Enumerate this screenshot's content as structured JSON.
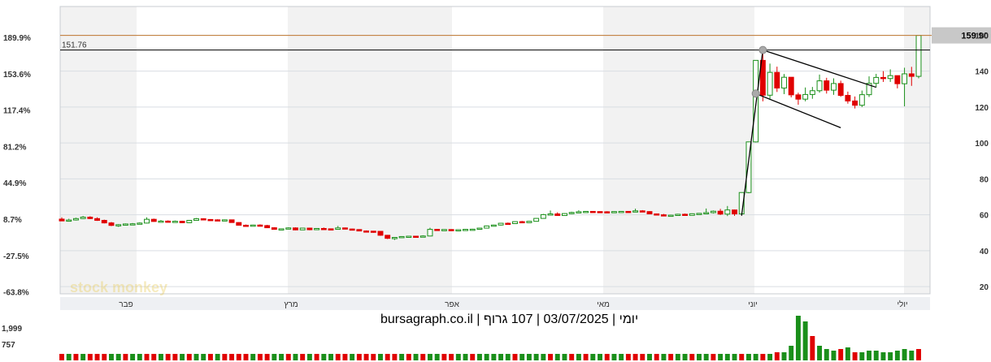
{
  "chart_data": {
    "type": "candlestick",
    "caption": "יומי | 03/07/2025 | 107 גרוף | bursagraph.co.il",
    "watermark": "stock monkey",
    "months": [
      "פבר",
      "מרץ",
      "אפר",
      "מאי",
      "יוני",
      "יולי"
    ],
    "y_right": {
      "ticks": [
        20,
        40,
        60,
        80,
        100,
        120,
        140,
        160
      ],
      "range": [
        16,
        176
      ]
    },
    "y_left_pct_ticks": [
      "189.9%",
      "153.6%",
      "117.4%",
      "81.2%",
      "44.9%",
      "8.7%",
      "-27.5%",
      "-63.8%"
    ],
    "volume_ticks": [
      "1,999",
      "757"
    ],
    "last_price_label": "159.90",
    "last_price": 159.9,
    "reference_level_label": "151.76",
    "reference_level": 151.76,
    "colors": {
      "up": "#1a8f1a",
      "down": "#e00000",
      "up_body": "#ffffff",
      "orange_line": "#c07830",
      "price_box": "#c8c8c8",
      "band": "#f2f2f2"
    },
    "candles": [
      [
        57.6,
        58.6,
        56.6,
        56.6
      ],
      [
        56.6,
        57.8,
        56.2,
        57.1
      ],
      [
        57.1,
        58.4,
        56.8,
        57.9
      ],
      [
        57.9,
        59.3,
        57.6,
        58.7
      ],
      [
        58.7,
        59.2,
        57.6,
        57.9
      ],
      [
        57.9,
        58.6,
        56.6,
        56.9
      ],
      [
        56.9,
        57.3,
        55.2,
        55.5
      ],
      [
        55.5,
        56.0,
        53.7,
        54.1
      ],
      [
        54.1,
        54.8,
        53.3,
        54.5
      ],
      [
        54.5,
        55.2,
        54.3,
        54.9
      ],
      [
        54.9,
        55.4,
        54.6,
        55.0
      ],
      [
        55.0,
        55.8,
        54.8,
        55.4
      ],
      [
        55.4,
        58.6,
        55.2,
        57.5
      ],
      [
        57.5,
        57.9,
        56.1,
        56.3
      ],
      [
        56.3,
        57.1,
        55.8,
        56.5
      ],
      [
        56.5,
        56.9,
        55.7,
        55.9
      ],
      [
        55.9,
        56.8,
        55.6,
        56.4
      ],
      [
        56.4,
        56.7,
        55.4,
        55.6
      ],
      [
        55.6,
        57.1,
        55.4,
        56.9
      ],
      [
        56.9,
        58.2,
        56.7,
        57.8
      ],
      [
        57.8,
        58.1,
        57.1,
        57.4
      ],
      [
        57.4,
        57.6,
        56.9,
        57.2
      ],
      [
        57.2,
        57.5,
        56.8,
        57.0
      ],
      [
        57.0,
        57.4,
        56.6,
        57.2
      ],
      [
        57.2,
        57.3,
        55.6,
        55.7
      ],
      [
        55.7,
        55.9,
        54.0,
        54.2
      ],
      [
        54.2,
        54.6,
        53.6,
        53.9
      ],
      [
        53.9,
        54.5,
        53.7,
        54.3
      ],
      [
        54.3,
        54.7,
        53.9,
        54.0
      ],
      [
        54.0,
        54.4,
        52.6,
        52.8
      ],
      [
        52.8,
        53.1,
        51.7,
        51.9
      ],
      [
        51.9,
        52.3,
        51.8,
        52.2
      ],
      [
        52.2,
        53.0,
        52.0,
        52.7
      ],
      [
        52.7,
        53.0,
        51.4,
        51.6
      ],
      [
        51.6,
        52.8,
        51.5,
        52.6
      ],
      [
        52.6,
        52.8,
        51.4,
        51.7
      ],
      [
        51.7,
        52.6,
        51.6,
        52.4
      ],
      [
        52.4,
        52.9,
        52.1,
        52.2
      ],
      [
        52.2,
        52.4,
        51.6,
        51.9
      ],
      [
        51.9,
        53.8,
        51.8,
        52.7
      ],
      [
        52.7,
        52.9,
        51.9,
        52.1
      ],
      [
        52.1,
        52.3,
        51.6,
        51.8
      ],
      [
        51.8,
        52.0,
        50.9,
        51.0
      ],
      [
        51.0,
        51.3,
        50.7,
        50.9
      ],
      [
        50.9,
        51.0,
        50.0,
        50.8
      ],
      [
        50.8,
        50.9,
        48.3,
        48.6
      ],
      [
        48.6,
        48.8,
        46.5,
        46.9
      ],
      [
        46.9,
        47.2,
        46.0,
        47.4
      ],
      [
        47.4,
        48.1,
        47.1,
        47.9
      ],
      [
        47.9,
        48.2,
        47.4,
        48.1
      ],
      [
        48.1,
        48.3,
        47.9,
        48.0
      ],
      [
        48.0,
        48.6,
        47.9,
        48.2
      ],
      [
        48.2,
        52.8,
        48.0,
        51.9
      ],
      [
        51.9,
        52.1,
        51.4,
        51.7
      ],
      [
        51.7,
        51.9,
        51.5,
        51.8
      ],
      [
        51.8,
        52.0,
        51.4,
        51.6
      ],
      [
        51.6,
        51.9,
        51.5,
        51.7
      ],
      [
        51.7,
        52.0,
        51.5,
        51.9
      ],
      [
        51.9,
        52.2,
        51.6,
        52.0
      ],
      [
        52.0,
        52.8,
        51.9,
        52.6
      ],
      [
        52.6,
        54.0,
        52.4,
        53.8
      ],
      [
        53.8,
        54.5,
        53.5,
        54.3
      ],
      [
        54.3,
        55.5,
        54.0,
        55.3
      ],
      [
        55.3,
        55.7,
        54.8,
        55.1
      ],
      [
        55.1,
        56.4,
        55.0,
        56.2
      ],
      [
        56.2,
        56.6,
        55.4,
        55.6
      ],
      [
        55.6,
        56.6,
        55.4,
        56.4
      ],
      [
        56.4,
        58.2,
        56.2,
        58.0
      ],
      [
        58.0,
        60.5,
        57.8,
        60.1
      ],
      [
        60.1,
        62.4,
        59.8,
        60.5
      ],
      [
        60.5,
        61.4,
        59.4,
        59.6
      ],
      [
        59.6,
        60.9,
        59.5,
        60.7
      ],
      [
        60.7,
        61.7,
        60.4,
        61.3
      ],
      [
        61.3,
        62.5,
        61.0,
        61.7
      ],
      [
        61.7,
        62.1,
        61.4,
        61.9
      ],
      [
        61.9,
        62.1,
        61.5,
        61.8
      ],
      [
        61.8,
        62.0,
        61.5,
        61.7
      ],
      [
        61.7,
        62.0,
        61.4,
        61.6
      ],
      [
        61.6,
        61.9,
        61.4,
        61.8
      ],
      [
        61.8,
        62.0,
        61.6,
        61.9
      ],
      [
        61.9,
        62.1,
        61.5,
        61.7
      ],
      [
        61.7,
        63.4,
        61.6,
        62.2
      ],
      [
        62.2,
        62.6,
        61.5,
        61.8
      ],
      [
        61.8,
        62.0,
        60.3,
        60.5
      ],
      [
        60.5,
        60.7,
        59.8,
        60.0
      ],
      [
        60.0,
        60.5,
        59.3,
        59.5
      ],
      [
        59.5,
        60.1,
        59.2,
        59.8
      ],
      [
        59.8,
        60.6,
        59.6,
        60.3
      ],
      [
        60.3,
        60.7,
        59.5,
        59.7
      ],
      [
        59.7,
        60.8,
        59.6,
        60.6
      ],
      [
        60.6,
        61.0,
        60.2,
        60.8
      ],
      [
        60.8,
        63.5,
        60.6,
        61.2
      ],
      [
        61.2,
        62.4,
        60.7,
        62.0
      ],
      [
        62.0,
        63.3,
        59.9,
        60.4
      ],
      [
        60.4,
        64.9,
        59.3,
        62.7
      ],
      [
        62.7,
        62.9,
        59.4,
        60.5
      ],
      [
        60.5,
        70.8,
        60.3,
        72.4
      ],
      [
        72.4,
        98.2,
        72.0,
        100.6
      ],
      [
        100.6,
        141.9,
        100.3,
        146.0
      ],
      [
        146.0,
        151.0,
        123.2,
        126.6
      ],
      [
        126.6,
        144.2,
        124.0,
        139.3
      ],
      [
        139.3,
        142.5,
        128.4,
        130.6
      ],
      [
        130.6,
        138.4,
        127.2,
        136.6
      ],
      [
        136.6,
        135.7,
        125.4,
        126.8
      ],
      [
        126.8,
        128.0,
        121.3,
        124.4
      ],
      [
        124.4,
        130.9,
        123.2,
        127.0
      ],
      [
        127.0,
        131.2,
        124.6,
        129.1
      ],
      [
        129.1,
        138.1,
        128.0,
        134.6
      ],
      [
        134.6,
        136.3,
        127.5,
        129.4
      ],
      [
        129.4,
        136.0,
        126.8,
        133.1
      ],
      [
        133.1,
        134.7,
        125.7,
        126.5
      ],
      [
        126.5,
        128.6,
        121.9,
        123.4
      ],
      [
        123.4,
        125.9,
        119.2,
        121.0
      ],
      [
        121.0,
        129.2,
        120.0,
        126.9
      ],
      [
        126.9,
        137.1,
        125.6,
        133.2
      ],
      [
        133.2,
        138.5,
        131.0,
        136.5
      ],
      [
        136.5,
        140.0,
        134.0,
        135.9
      ],
      [
        135.9,
        141.0,
        134.0,
        137.5
      ],
      [
        137.5,
        136.3,
        130.4,
        133.0
      ],
      [
        133.0,
        141.9,
        120.4,
        138.5
      ],
      [
        138.5,
        142.4,
        131.8,
        137.1
      ],
      [
        137.1,
        158.0,
        136.0,
        159.9
      ]
    ],
    "volume": [
      "r",
      "g",
      "r",
      "g",
      "r",
      "r",
      "r",
      "g",
      "g",
      "r",
      "g",
      "g",
      "r",
      "r",
      "g",
      "r",
      "r",
      "g",
      "r",
      "g",
      "g",
      "r",
      "g",
      "r",
      "r",
      "r",
      "r",
      "g",
      "r",
      "r",
      "g",
      "g",
      "r",
      "g",
      "r",
      "g",
      "r",
      "g",
      "g",
      "r",
      "r",
      "g",
      "r",
      "r",
      "r",
      "g",
      "r",
      "r",
      "g",
      "r",
      "g",
      "r",
      "g",
      "g",
      "r",
      "r",
      "g",
      "g",
      "r",
      "g",
      "g",
      "g",
      "g",
      "g",
      "r",
      "g",
      "g",
      "g",
      "g",
      "r",
      "g",
      "g",
      "r",
      "g",
      "r",
      "g",
      "g",
      "r",
      "g",
      "g",
      "r",
      "r",
      "r",
      "g",
      "r",
      "g",
      "r",
      "g",
      "g",
      "r",
      "g",
      "g",
      "r",
      "g",
      "g",
      "g",
      "r",
      "g",
      "g",
      "r",
      "g",
      "r",
      "g",
      "g",
      "g",
      "g",
      "r",
      "g",
      "g",
      "g",
      "r",
      "g",
      "r",
      "g",
      "g",
      "g",
      "g",
      "g",
      "g",
      "g",
      "g",
      "r",
      "g",
      "g"
    ],
    "volume_heights": [
      8,
      8,
      8,
      8,
      8,
      8,
      8,
      8,
      8,
      8,
      8,
      8,
      8,
      8,
      8,
      8,
      8,
      8,
      8,
      8,
      8,
      8,
      8,
      8,
      8,
      8,
      8,
      8,
      8,
      8,
      8,
      8,
      8,
      8,
      8,
      8,
      8,
      8,
      8,
      8,
      8,
      8,
      8,
      8,
      8,
      8,
      8,
      8,
      8,
      8,
      8,
      8,
      8,
      8,
      8,
      8,
      8,
      8,
      8,
      8,
      8,
      8,
      8,
      8,
      8,
      8,
      8,
      8,
      8,
      8,
      8,
      8,
      8,
      8,
      8,
      8,
      8,
      8,
      8,
      8,
      8,
      8,
      8,
      8,
      8,
      8,
      8,
      8,
      8,
      8,
      8,
      8,
      8,
      8,
      8,
      8,
      8,
      8,
      8,
      8,
      8,
      10,
      10,
      18,
      55,
      48,
      30,
      18,
      14,
      12,
      14,
      16,
      10,
      10,
      12,
      12,
      10,
      10,
      12,
      14,
      12,
      14,
      16,
      36
    ]
  }
}
